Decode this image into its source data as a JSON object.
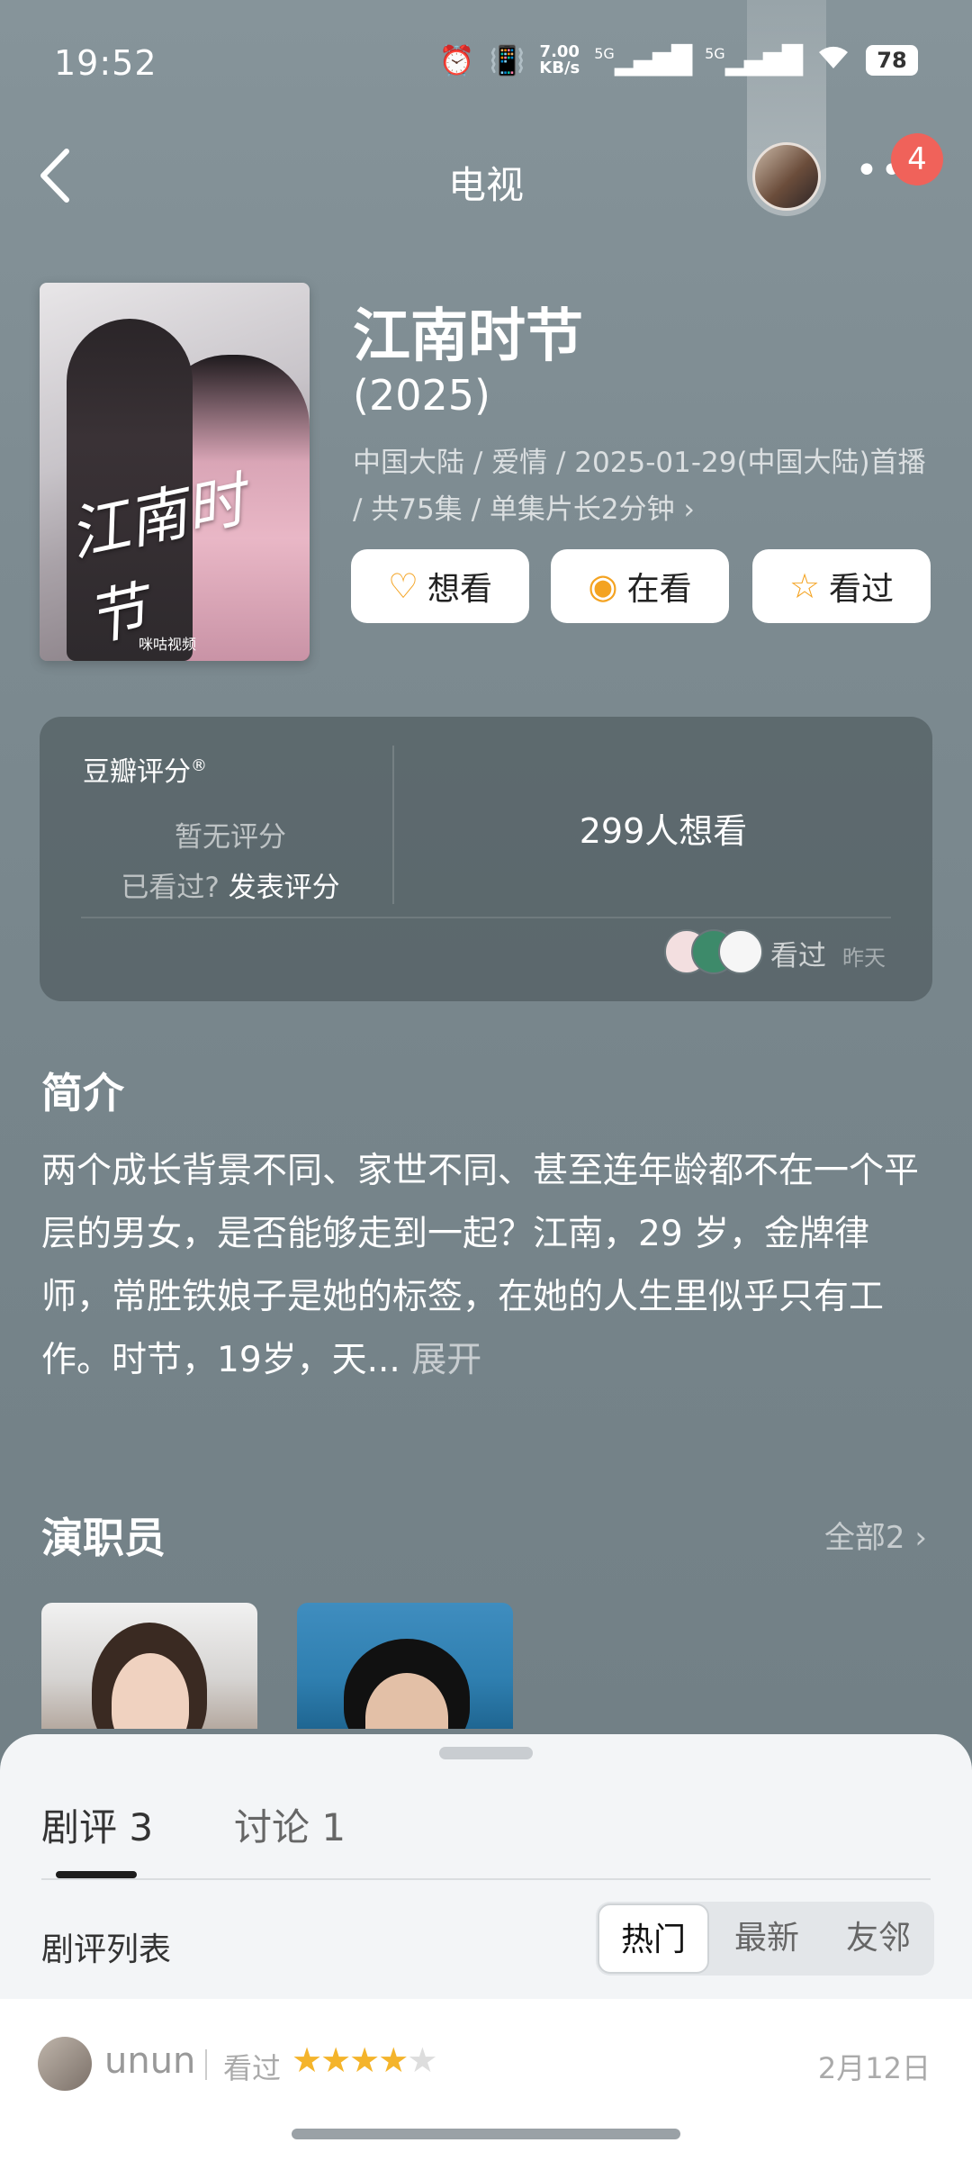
{
  "status_bar": {
    "time": "19:52",
    "alarm_icon": "alarm-icon",
    "vibrate_icon": "vibrate-icon",
    "speed_value": "7.00",
    "speed_unit": "KB/s",
    "net1": "5G",
    "net2": "5G",
    "wifi_icon": "wifi-icon",
    "battery": "78"
  },
  "header": {
    "title": "电视",
    "notification_count": "4"
  },
  "show": {
    "poster_title": "江南时节",
    "poster_logo": "咪咕视频",
    "title": "江南时节",
    "year": "(2025)",
    "meta": "中国大陆 / 爱情 / 2025-01-29(中国大陆)首播 / 共75集 / 单集片长2分钟",
    "meta_chevron": "›"
  },
  "actions": {
    "want": "想看",
    "watching": "在看",
    "watched": "看过"
  },
  "rating": {
    "title": "豆瓣评分",
    "title_mark": "®",
    "no_rating": "暂无评分",
    "seen_prompt": "已看过?",
    "post_rating": "发表评分",
    "want_count": "299人想看",
    "friends_status": "看过",
    "friends_time": "昨天"
  },
  "synopsis": {
    "title": "简介",
    "text": "两个成长背景不同、家世不同、甚至连年龄都不在一个平 层的男女，是否能够走到一起？江南，29 岁，金牌律师，常胜铁娘子是她的标签，在她的人生里似乎只有工作。时节，19岁，天...",
    "expand": "展开"
  },
  "cast": {
    "title": "演职员",
    "all": "全部2"
  },
  "sheet": {
    "tab_reviews": "剧评 3",
    "tab_discuss": "讨论 1",
    "list_title": "剧评列表",
    "seg": [
      "热门",
      "最新",
      "友邻"
    ],
    "review": {
      "user": "unun",
      "status": "看过",
      "rating": 4,
      "max_rating": 5,
      "date": "2月12日"
    }
  },
  "colors": {
    "accent_orange": "#f4a321",
    "badge_red": "#f0625a",
    "star": "#f4b42b"
  }
}
